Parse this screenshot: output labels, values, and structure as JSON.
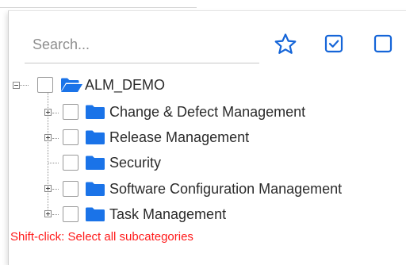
{
  "search": {
    "placeholder": "Search..."
  },
  "toolbar": {
    "favorites_icon": "star-outline-icon",
    "select_all_icon": "checked-square-icon",
    "clear_icon": "empty-square-icon",
    "accent_color": "#1565d8"
  },
  "tree": {
    "root": {
      "label": "ALM_DEMO",
      "expanded": true,
      "checked": false,
      "icon": "folder-open-icon"
    },
    "children": [
      {
        "label": "Change & Defect Management",
        "expandable": true,
        "checked": false,
        "icon": "folder-icon"
      },
      {
        "label": "Release Management",
        "expandable": true,
        "checked": false,
        "icon": "folder-icon"
      },
      {
        "label": "Security",
        "expandable": false,
        "checked": false,
        "icon": "folder-icon"
      },
      {
        "label": "Software Configuration Management",
        "expandable": true,
        "checked": false,
        "icon": "folder-icon"
      },
      {
        "label": "Task Management",
        "expandable": true,
        "checked": false,
        "icon": "folder-icon"
      }
    ]
  },
  "hint": {
    "text": "Shift-click: Select all subcategories",
    "color": "#ff1a1a"
  },
  "colors": {
    "folder": "#1a73e8",
    "text": "#2b2b2b"
  }
}
